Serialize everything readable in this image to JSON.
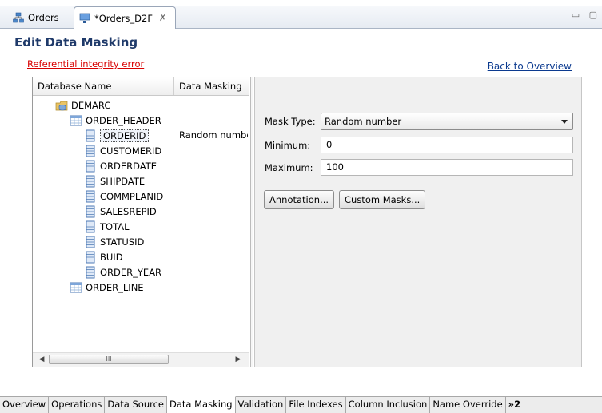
{
  "tabs": {
    "orders": "Orders",
    "active": "*Orders_D2F",
    "close_glyph": "✗"
  },
  "page": {
    "title": "Edit Data Masking",
    "error_link": "Referential integrity error",
    "back_link": "Back to Overview"
  },
  "tree": {
    "col_name": "Database Name",
    "col_mask": "Data Masking",
    "database": "DEMARC",
    "table1": "ORDER_HEADER",
    "columns": [
      "ORDERID",
      "CUSTOMERID",
      "ORDERDATE",
      "SHIPDATE",
      "COMMPLANID",
      "SALESREPID",
      "TOTAL",
      "STATUSID",
      "BUID",
      "ORDER_YEAR"
    ],
    "selected_mask": "Random number",
    "table2": "ORDER_LINE",
    "scroll_grip": "III"
  },
  "details": {
    "mask_type_label": "Mask Type:",
    "mask_type_value": "Random number",
    "min_label": "Minimum:",
    "min_value": "0",
    "max_label": "Maximum:",
    "max_value": "100",
    "annotation_btn": "Annotation...",
    "custom_btn": "Custom Masks..."
  },
  "bottom_tabs": [
    "Overview",
    "Operations",
    "Data Source",
    "Data Masking",
    "Validation",
    "File Indexes",
    "Column Inclusion",
    "Name Override"
  ],
  "bottom_more": "»2",
  "colors": {
    "title": "#1f3a6a",
    "error": "#d80000",
    "link": "#0b3a8f"
  }
}
